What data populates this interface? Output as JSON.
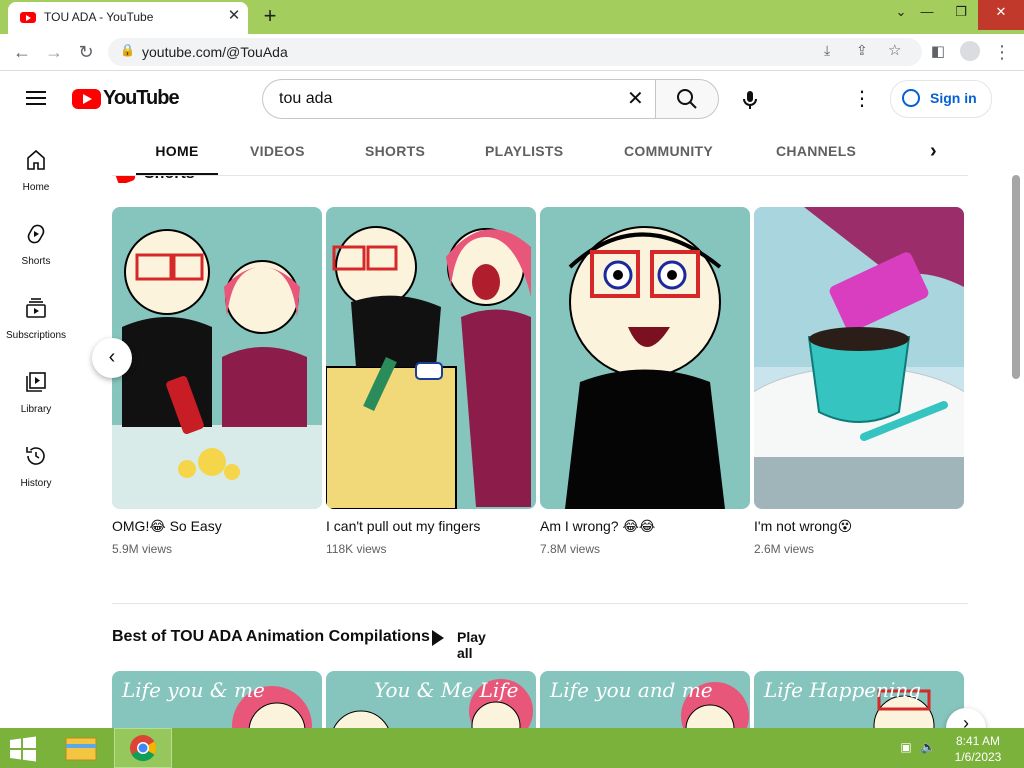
{
  "browser": {
    "tab_title": "TOU ADA - YouTube",
    "url": "youtube.com/@TouAda"
  },
  "masthead": {
    "logo_text": "YouTube",
    "search_value": "tou ada",
    "signin_label": "Sign in"
  },
  "sidebar": {
    "items": [
      {
        "label": "Home",
        "icon": "home-icon"
      },
      {
        "label": "Shorts",
        "icon": "shorts-icon"
      },
      {
        "label": "Subscriptions",
        "icon": "subscriptions-icon"
      },
      {
        "label": "Library",
        "icon": "library-icon"
      },
      {
        "label": "History",
        "icon": "history-icon"
      }
    ]
  },
  "channel_tabs": [
    {
      "label": "HOME",
      "active": true
    },
    {
      "label": "VIDEOS",
      "active": false
    },
    {
      "label": "SHORTS",
      "active": false
    },
    {
      "label": "PLAYLISTS",
      "active": false
    },
    {
      "label": "COMMUNITY",
      "active": false
    },
    {
      "label": "CHANNELS",
      "active": false
    }
  ],
  "shorts_shelf": {
    "title": "Shorts",
    "items": [
      {
        "title": "OMG!😂 So Easy",
        "views": "5.9M views"
      },
      {
        "title": "I can't pull out my fingers",
        "views": "118K views"
      },
      {
        "title": "Am I wrong? 😂😂",
        "views": "7.8M views"
      },
      {
        "title": "I'm not wrong😵",
        "views": "2.6M views"
      }
    ]
  },
  "playlist_shelf": {
    "title": "Best of TOU ADA Animation Compilations",
    "play_all_label": "Play all",
    "thumb_texts": [
      "Life you & me",
      "You & Me Life",
      "Life you and me",
      "Life Happening"
    ]
  },
  "taskbar": {
    "time": "8:41 AM",
    "date": "1/6/2023"
  },
  "colors": {
    "titlebar": "#a3cd5c",
    "taskbar": "#7ab23b",
    "youtube_red": "#ff0000",
    "signin_blue": "#065fd4"
  }
}
